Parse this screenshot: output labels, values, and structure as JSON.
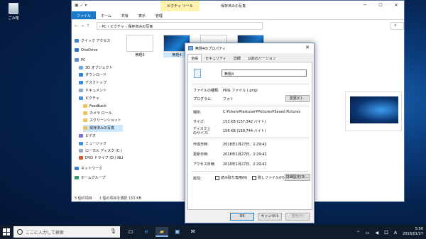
{
  "desktop": {
    "recycle_bin_label": "ごみ箱"
  },
  "explorer": {
    "title": "保存済みの写真",
    "context_tab": "ピクチャ ツール",
    "quick_access_icons": "▣ ✓ ▾",
    "ribbon_tabs": [
      "ファイル",
      "ホーム",
      "共有",
      "表示",
      "管理"
    ],
    "address_parts": [
      "PC",
      "ピクチャ",
      "保存済みの写真"
    ],
    "address_separator": "›",
    "nav": [
      {
        "label": "クイック アクセス",
        "color": "#3f7fd6"
      },
      {
        "label": "OneDrive",
        "color": "#2a6fd1"
      },
      {
        "label": "PC",
        "color": "#5b8fd0"
      },
      {
        "label": "3D オブジェクト",
        "color": "#6aa4e0"
      },
      {
        "label": "ダウンロード",
        "color": "#2f7fd8"
      },
      {
        "label": "デスクトップ",
        "color": "#3e8ad8"
      },
      {
        "label": "ドキュメント",
        "color": "#8fa6bf"
      },
      {
        "label": "ピクチャ",
        "color": "#4a90d9"
      },
      {
        "label": "Feedback",
        "color": "#e8c45a"
      },
      {
        "label": "カメラ ロール",
        "color": "#e8c45a"
      },
      {
        "label": "スクリーンショット",
        "color": "#e8c45a"
      },
      {
        "label": "保存済みの写真",
        "color": "#e8c45a"
      },
      {
        "label": "ビデオ",
        "color": "#7a6fc9"
      },
      {
        "label": "ミュージック",
        "color": "#3f8fd6"
      },
      {
        "label": "ローカル ディスク (C:)",
        "color": "#9aa5b1"
      },
      {
        "label": "DVD ドライブ (D:) NLI",
        "color": "#d05a30"
      },
      {
        "label": "ネットワーク",
        "color": "#3f7fd6"
      },
      {
        "label": "ホームグループ",
        "color": "#2f9e6f"
      }
    ],
    "thumbnails": [
      {
        "label": "無題3"
      },
      {
        "label": "無題4"
      },
      {
        "label": ""
      },
      {
        "label": ""
      }
    ],
    "status": "5 個の項目　　1 個の項目を選択 153 KB"
  },
  "dialog": {
    "title": "無題4のプロパティ",
    "close_glyph": "✕",
    "tabs": [
      "全般",
      "セキュリティ",
      "詳細",
      "以前のバージョン"
    ],
    "name_value": "無題4",
    "file_type_label": "ファイルの種類:",
    "file_type_value": "PNG ファイル (.png)",
    "program_label": "プログラム:",
    "program_value": "フォト",
    "change_button": "変更(C)...",
    "location_label": "場所:",
    "location_value": "C:¥Users¥testuser¥Pictures¥Saved Pictures",
    "size_label": "サイズ:",
    "size_value": "153 KB (157,342 バイト)",
    "disk_size_label_1": "ディスク上",
    "disk_size_label_2": "のサイズ:",
    "disk_size_value": "156 KB (159,744 バイト)",
    "created_label": "作成日時:",
    "created_value": "2018年1月27日、2:29:42",
    "modified_label": "更新日時:",
    "modified_value": "2018年1月27日、2:29:42",
    "accessed_label": "アクセス日時:",
    "accessed_value": "2018年1月27日、2:29:42",
    "attributes_label": "属性:",
    "readonly_label": "読み取り専用(R)",
    "hidden_label": "隠しファイル(H)",
    "advanced_button": "詳細設定(D)...",
    "ok_button": "OK",
    "cancel_button": "キャンセル",
    "apply_button": "適用(A)"
  },
  "taskbar": {
    "search_placeholder": "ここに入力して検索",
    "time": "5:50",
    "date": "2018/01/27",
    "tray_icons": "⌃ ▭ ◀ 口 A"
  }
}
